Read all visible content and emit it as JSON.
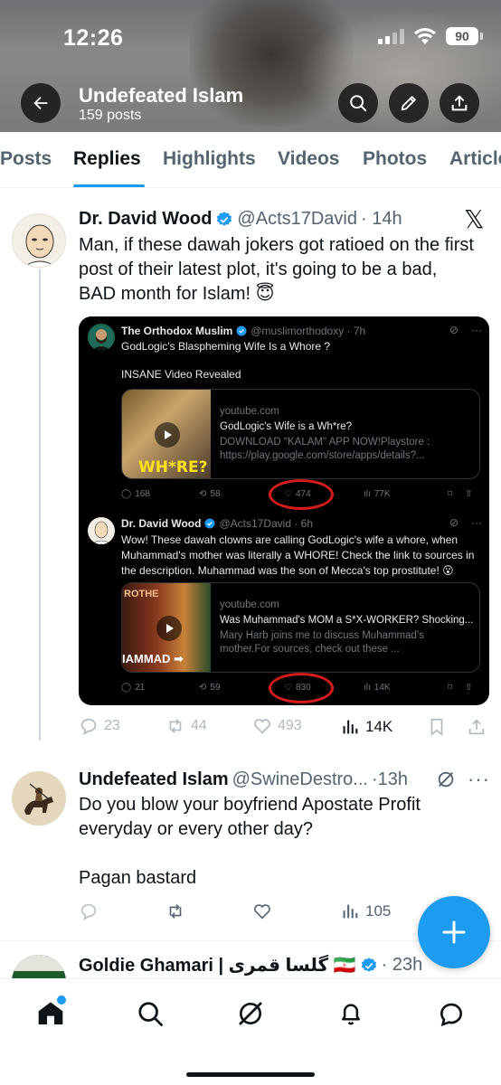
{
  "status": {
    "time": "12:26",
    "battery": "90"
  },
  "header": {
    "name": "Undefeated Islam",
    "posts": "159 posts"
  },
  "tabs": [
    "Posts",
    "Replies",
    "Highlights",
    "Videos",
    "Photos",
    "Articles"
  ],
  "tweet1": {
    "name": "Dr. David Wood",
    "handle": "@Acts17David",
    "time": "· 14h",
    "body": "Man, if these dawah jokers got ratioed on the first post of their latest plot, it's going to be a bad, BAD month for Islam! 😇",
    "replies": "23",
    "reposts": "44",
    "likes": "493",
    "views": "14K"
  },
  "embed": {
    "post1": {
      "name": "The Orthodox Muslim",
      "handle": "@muslimorthodoxy · 7h",
      "line1": "GodLogic's Blaspheming Wife Is a Whore ?",
      "line2": "INSANE Video Revealed",
      "card_domain": "youtube.com",
      "card_title": "GodLogic's Wife is a Wh*re?",
      "card_desc": "DOWNLOAD \"KALAM\" APP NOW!Playstore : https://play.google.com/store/apps/details?...",
      "thumb_text": "WH*RE?",
      "replies": "168",
      "reposts": "58",
      "likes": "474",
      "views": "77K"
    },
    "post2": {
      "name": "Dr. David Wood",
      "handle": "@Acts17David · 6h",
      "body": "Wow! These dawah clowns are calling GodLogic's wife a whore, when Muhammad's mother was literally a WHORE! Check the link to sources in the description. Muhammad was the son of Mecca's top prostitute! 😮",
      "card_domain": "youtube.com",
      "card_title": "Was Muhammad's MOM a S*X-WORKER? Shocking...",
      "card_desc": "Mary Harb joins me to discuss Muhammad's mother.For sources, check out these ...",
      "thumb_text": "IAMMAD ➡",
      "thumb_sign": "ROTHE",
      "replies": "21",
      "reposts": "59",
      "likes": "830",
      "views": "14K"
    }
  },
  "tweet2": {
    "name": "Undefeated Islam",
    "handle": "@SwineDestro...",
    "time": "·13h",
    "line1": "Do you blow your boyfriend Apostate Profit",
    "line2": "everyday or every other day?",
    "line3": "Pagan bastard",
    "views": "105"
  },
  "tweet3": {
    "name": "Goldie Ghamari | گلسا قمری 🇮🇷",
    "time": "· 23h"
  },
  "colors": {
    "accent": "#1d9bf0",
    "ring": "#d61b1b",
    "text": "#0f1419",
    "muted": "#536471"
  }
}
